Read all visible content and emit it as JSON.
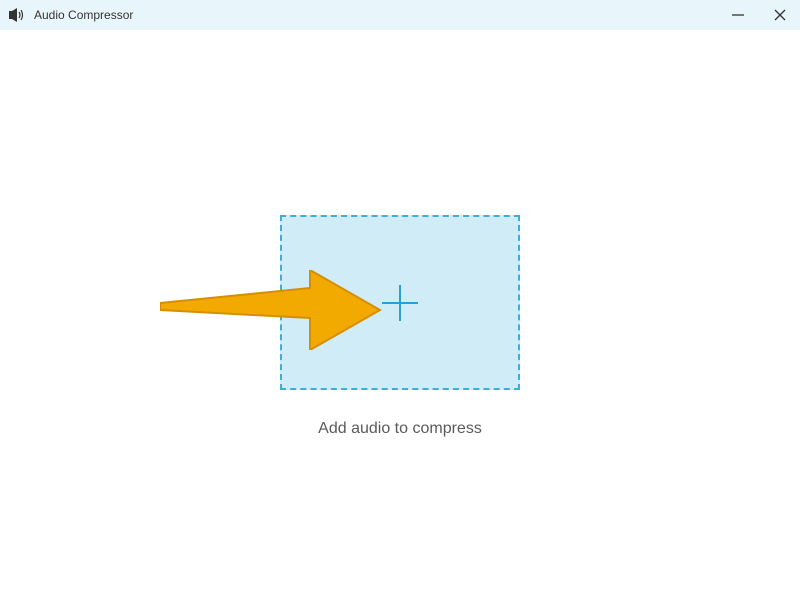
{
  "titlebar": {
    "title": "Audio Compressor"
  },
  "dropzone": {
    "instruction": "Add audio to compress"
  },
  "colors": {
    "titlebar_bg": "#e8f6fc",
    "dropzone_bg": "#d0ecf7",
    "dropzone_border": "#3daed9",
    "plus_color": "#2a9fd6",
    "arrow_color": "#f2a900",
    "text_color": "#5a5a5a"
  }
}
